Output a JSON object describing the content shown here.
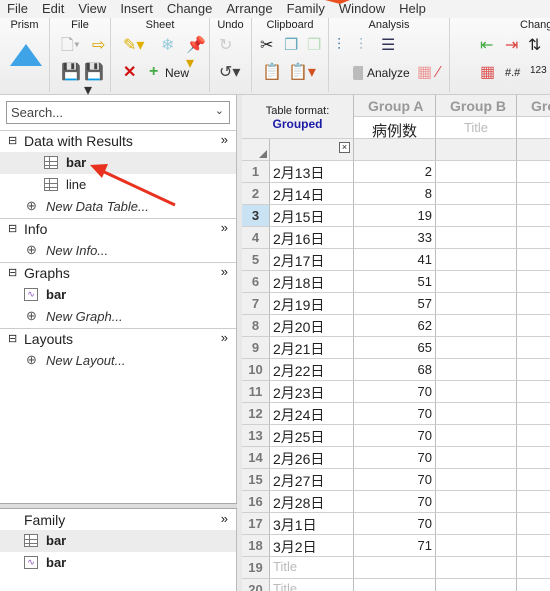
{
  "menu": [
    "File",
    "Edit",
    "View",
    "Insert",
    "Change",
    "Arrange",
    "Family",
    "Window",
    "Help"
  ],
  "ribbon": {
    "groups": [
      "Prism",
      "File",
      "Sheet",
      "Undo",
      "Clipboard",
      "Analysis",
      "Chang"
    ],
    "new_label": "New",
    "analyze_label": "Analyze"
  },
  "search": {
    "placeholder": "Search..."
  },
  "navigator": {
    "data_section": "Data with Results",
    "data_items": [
      "bar",
      "line"
    ],
    "new_data": "New Data Table...",
    "info_section": "Info",
    "new_info": "New Info...",
    "graphs_section": "Graphs",
    "graph_items": [
      "bar"
    ],
    "new_graph": "New Graph...",
    "layouts_section": "Layouts",
    "new_layout": "New Layout..."
  },
  "family": {
    "title": "Family",
    "items": [
      "bar",
      "bar"
    ]
  },
  "table": {
    "format_label": "Table format:",
    "format_value": "Grouped",
    "groups": [
      "Group A",
      "Group B",
      "Gro"
    ],
    "titles": [
      "病例数",
      "Title",
      "T"
    ],
    "active_row": 3,
    "rows": [
      [
        "2月13日",
        "2"
      ],
      [
        "2月14日",
        "8"
      ],
      [
        "2月15日",
        "19"
      ],
      [
        "2月16日",
        "33"
      ],
      [
        "2月17日",
        "41"
      ],
      [
        "2月18日",
        "51"
      ],
      [
        "2月19日",
        "57"
      ],
      [
        "2月20日",
        "62"
      ],
      [
        "2月21日",
        "65"
      ],
      [
        "2月22日",
        "68"
      ],
      [
        "2月23日",
        "70"
      ],
      [
        "2月24日",
        "70"
      ],
      [
        "2月25日",
        "70"
      ],
      [
        "2月26日",
        "70"
      ],
      [
        "2月27日",
        "70"
      ],
      [
        "2月28日",
        "70"
      ],
      [
        "3月1日",
        "70"
      ],
      [
        "3月2日",
        "71"
      ]
    ],
    "empty_row_placeholder": "Title",
    "extra_row_numbers": [
      "19",
      "20"
    ]
  },
  "colors": {
    "accent": "#1a1aa6",
    "annotation_arrow": "#e8321f",
    "active_row": "#c9e3f5"
  }
}
